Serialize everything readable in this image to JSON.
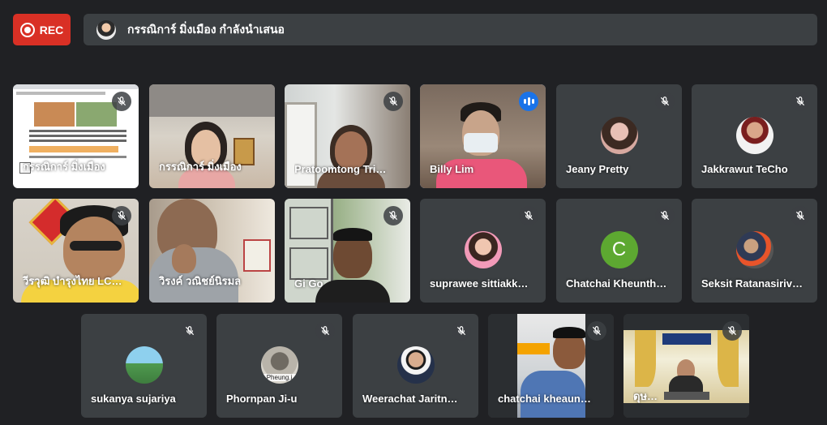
{
  "recording": {
    "label": "REC",
    "color": "#d93025"
  },
  "presenting_banner": {
    "text": "กรรณิการ์ มิ่งเมือง กำลังนำเสนอ"
  },
  "participants": [
    {
      "name": "กรรณิการ์ มิ่งเมือง",
      "muted": true,
      "type": "screen"
    },
    {
      "name": "กรรณิการ์ มิ่งเมือง",
      "muted": false,
      "type": "video"
    },
    {
      "name": "Pratoomtong Tri…",
      "muted": true,
      "type": "video"
    },
    {
      "name": "Billy Lim",
      "muted": false,
      "speaking": true,
      "type": "video"
    },
    {
      "name": "Jeany Pretty",
      "muted": true,
      "type": "avatar"
    },
    {
      "name": "Jakkrawut TeCho",
      "muted": true,
      "type": "avatar"
    },
    {
      "name": "วีรวุฒิ บำรุงไทย LC…",
      "muted": true,
      "type": "video"
    },
    {
      "name": "วิรงค์ วณิชย์นิรมล",
      "muted": false,
      "type": "video"
    },
    {
      "name": "Gi Go",
      "muted": true,
      "type": "video"
    },
    {
      "name": "suprawee sittiakk…",
      "muted": true,
      "type": "avatar"
    },
    {
      "name": "Chatchai Kheunth…",
      "muted": true,
      "type": "avatar",
      "letter": "C"
    },
    {
      "name": "Seksit Ratanasiriv…",
      "muted": true,
      "type": "avatar"
    },
    {
      "name": "sukanya sujariya",
      "muted": true,
      "type": "avatar"
    },
    {
      "name": "Phornpan Ji-u",
      "muted": true,
      "type": "avatar",
      "avatar_caption": "Pheung.j"
    },
    {
      "name": "Weerachat Jaritn…",
      "muted": true,
      "type": "avatar"
    },
    {
      "name": "chatchai kheaun…",
      "muted": true,
      "type": "video"
    },
    {
      "name": "ดุษ…",
      "muted": true,
      "type": "video"
    }
  ]
}
